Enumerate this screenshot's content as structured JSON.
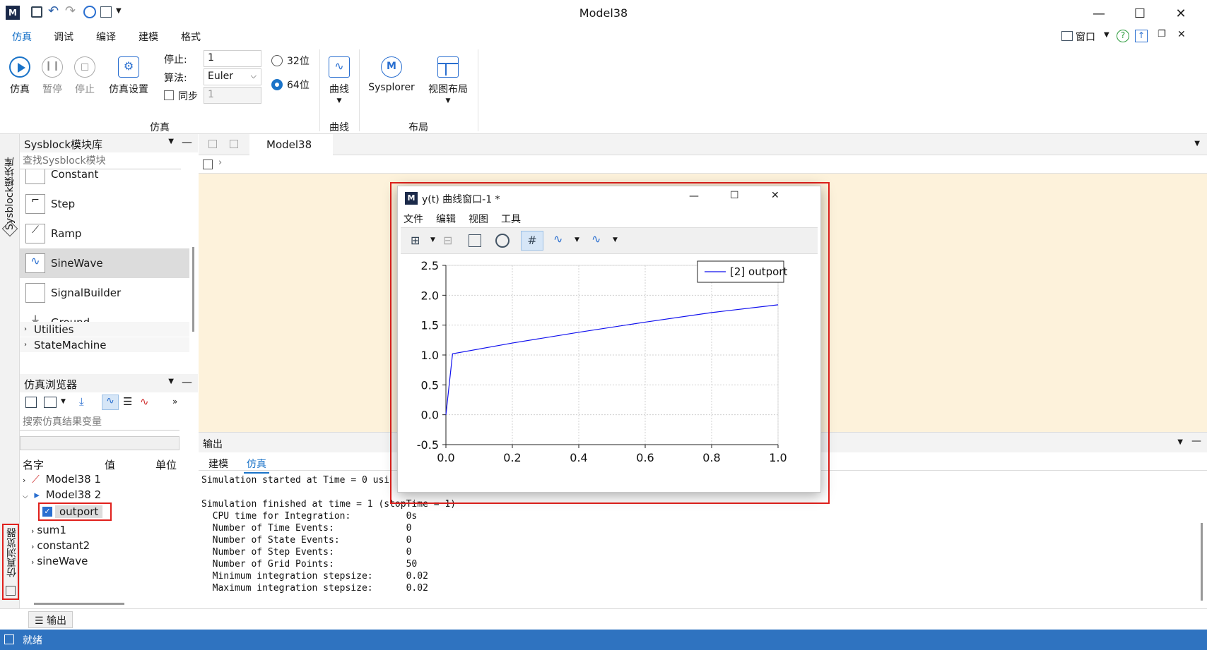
{
  "window": {
    "title": "Model38"
  },
  "menu_tabs": [
    "仿真",
    "调试",
    "编译",
    "建模",
    "格式"
  ],
  "top_right": {
    "window_label": "窗口"
  },
  "ribbon": {
    "sim_buttons": [
      {
        "label": "仿真",
        "icon": "play-icon",
        "enabled": true
      },
      {
        "label": "暂停",
        "icon": "pause-icon",
        "enabled": false
      },
      {
        "label": "停止",
        "icon": "stop-icon",
        "enabled": false
      },
      {
        "label": "仿真设置",
        "icon": "sim-settings-icon",
        "enabled": true
      }
    ],
    "stop_label": "停止:",
    "stop_value": "1",
    "algo_label": "算法:",
    "algo_value": "Euler",
    "sync_label": "同步",
    "sync_value": "1",
    "bit32": "32位",
    "bit64": "64位",
    "group_sim": "仿真",
    "curve_button": "曲线",
    "group_curve": "曲线",
    "sysplorer_button": "Sysplorer",
    "layout_button": "视图布局",
    "group_layout": "布局"
  },
  "left_strip": {
    "lib_tab": "Sysblock模块库",
    "browser_tab": "仿真浏览器"
  },
  "library": {
    "title": "Sysblock模块库",
    "search_placeholder": "查找Sysblock模块",
    "items": [
      "Constant",
      "Step",
      "Ramp",
      "SineWave",
      "SignalBuilder",
      "Ground"
    ],
    "selected": "SineWave",
    "groups": [
      "Utilities",
      "StateMachine"
    ]
  },
  "sim_browser": {
    "title": "仿真浏览器",
    "search_placeholder": "搜索仿真结果变量",
    "columns": [
      "名字",
      "值",
      "单位"
    ],
    "tree": [
      "Model38 1",
      "Model38 2",
      "outport",
      "sum1",
      "constant2",
      "sineWave"
    ]
  },
  "doc": {
    "tab": "Model38"
  },
  "output": {
    "title": "输出",
    "tabs": [
      "建模",
      "仿真"
    ],
    "active_tab": "仿真",
    "log": "Simulation started at Time = 0 usi\n\nSimulation finished at time = 1 (stopTime = 1)\n  CPU time for Integration:          0s\n  Number of Time Events:             0\n  Number of State Events:            0\n  Number of Step Events:             0\n  Number of Grid Points:             50\n  Minimum integration stepsize:      0.02\n  Maximum integration stepsize:      0.02"
  },
  "bottom": {
    "output_tab": "输出"
  },
  "status": {
    "text": "就绪"
  },
  "curve_window": {
    "title": "y(t) 曲线窗口-1 *",
    "menus": [
      "文件",
      "编辑",
      "视图",
      "工具"
    ]
  },
  "chart_data": {
    "type": "line",
    "title": "",
    "xlabel": "",
    "ylabel": "",
    "xlim": [
      0,
      1.0
    ],
    "ylim": [
      -0.5,
      2.5
    ],
    "xticks": [
      "0.0",
      "0.2",
      "0.4",
      "0.6",
      "0.8",
      "1.0"
    ],
    "yticks": [
      "-0.5",
      "0.0",
      "0.5",
      "1.0",
      "1.5",
      "2.0",
      "2.5"
    ],
    "grid": true,
    "legend": "top-right",
    "series": [
      {
        "name": "[2] outport",
        "color": "#1010ee",
        "x": [
          0,
          0.02,
          0.2,
          0.4,
          0.6,
          0.8,
          1.0
        ],
        "y": [
          0,
          1.02,
          1.2,
          1.38,
          1.55,
          1.71,
          1.84
        ]
      }
    ]
  }
}
